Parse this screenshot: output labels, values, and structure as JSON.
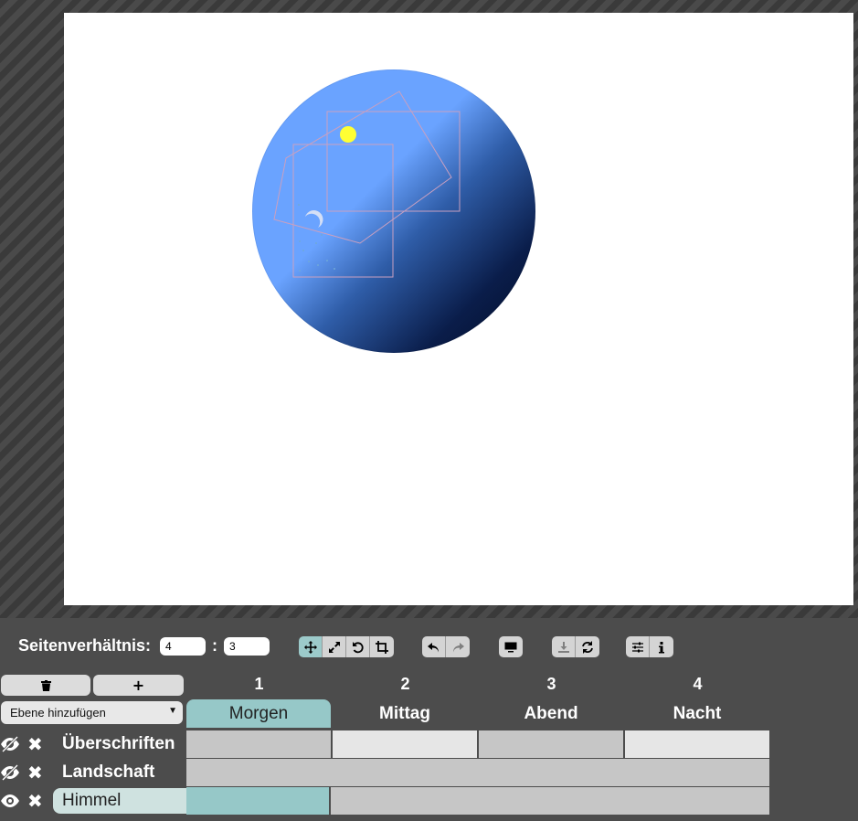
{
  "toolbar": {
    "aspect_label": "Seitenverhältnis:",
    "ratio_w": "4",
    "ratio_sep": ":",
    "ratio_h": "3",
    "tools": [
      "move-tool",
      "scale-tool",
      "rotate-tool",
      "crop-tool"
    ],
    "history": [
      "undo",
      "redo"
    ],
    "present": "present",
    "file": [
      "download",
      "reload"
    ],
    "meta": [
      "settings",
      "info"
    ]
  },
  "layer_controls": {
    "delete_label": "🗑",
    "add_label": "+",
    "add_layer_select": "Ebene hinzufügen"
  },
  "columns": [
    {
      "num": "1",
      "name": "Morgen"
    },
    {
      "num": "2",
      "name": "Mittag"
    },
    {
      "num": "3",
      "name": "Abend"
    },
    {
      "num": "4",
      "name": "Nacht"
    }
  ],
  "layers": [
    {
      "name": "Überschriften",
      "visible": false
    },
    {
      "name": "Landschaft",
      "visible": false
    },
    {
      "name": "Himmel",
      "visible": true,
      "selected": true
    }
  ],
  "colors": {
    "accent": "#96c8c8",
    "cell_dark": "#c6c6c6",
    "cell_light": "#e6e6e6",
    "sky_light": "#6aa3ff",
    "sky_dark": "#020c26",
    "sun": "#ffff33"
  }
}
